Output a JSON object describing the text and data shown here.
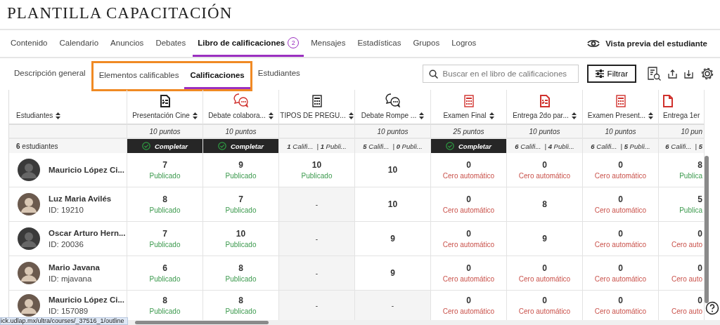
{
  "course_title": "PLANTILLA CAPACITACIÓN",
  "nav_tabs": [
    {
      "label": "Contenido",
      "selected": false
    },
    {
      "label": "Calendario",
      "selected": false
    },
    {
      "label": "Anuncios",
      "selected": false
    },
    {
      "label": "Debates",
      "selected": false
    },
    {
      "label": "Libro de calificaciones",
      "badge": "2",
      "selected": true
    },
    {
      "label": "Mensajes",
      "selected": false
    },
    {
      "label": "Estadísticas",
      "selected": false
    },
    {
      "label": "Grupos",
      "selected": false
    },
    {
      "label": "Logros",
      "selected": false
    }
  ],
  "student_preview": "Vista previa del estudiante",
  "sub_tabs": [
    {
      "label": "Descripción general",
      "selected": false,
      "highlighted": false
    },
    {
      "label": "Elementos calificables",
      "selected": false,
      "highlighted": true
    },
    {
      "label": "Calificaciones",
      "selected": true,
      "highlighted": true
    },
    {
      "label": "Estudiantes",
      "selected": false,
      "highlighted": false
    }
  ],
  "search": {
    "placeholder": "Buscar en el libro de calificaciones"
  },
  "filter_button": "Filtrar",
  "table": {
    "student_header": "Estudiantes",
    "student_count": "**6** estudiantes",
    "columns": [
      {
        "title": "Presentación Cine",
        "kind": "assignment",
        "color": "#222222",
        "points": "10 puntos",
        "summary": {
          "kind": "complete",
          "text": "Completar"
        }
      },
      {
        "title": "Debate colabora...",
        "kind": "discussion",
        "color": "#d0312d",
        "points": "10 puntos",
        "summary": {
          "kind": "complete",
          "text": "Completar"
        }
      },
      {
        "title": "TIPOS DE PREGU...",
        "kind": "test",
        "color": "#222222",
        "summary": {
          "kind": "counts",
          "text": "**1** Califi...  | **1** Publi..."
        }
      },
      {
        "title": "Debate Rompe ...",
        "kind": "discussion",
        "color": "#222222",
        "points": "10 puntos",
        "summary": {
          "kind": "counts",
          "text": "**5** Califi...  | **0** Publi..."
        }
      },
      {
        "title": "Examen Final",
        "kind": "test",
        "color": "#d0312d",
        "points": "25 puntos",
        "summary": {
          "kind": "complete",
          "text": "Completar"
        }
      },
      {
        "title": "Entrega 2do par...",
        "kind": "assignment",
        "color": "#d0312d",
        "points": "10 puntos",
        "summary": {
          "kind": "counts",
          "text": "**6** Califi...  | **4** Publi..."
        }
      },
      {
        "title": "Examen Present...",
        "kind": "test",
        "color": "#d0312d",
        "points": "10 puntos",
        "summary": {
          "kind": "counts",
          "text": "**6** Califi...  | **5** Publi..."
        }
      },
      {
        "title": "Entrega 1er",
        "kind": "document",
        "color": "#d0312d",
        "points": "10 pun",
        "summary": {
          "kind": "counts",
          "text": "**6** Califi...  | **5**"
        }
      }
    ],
    "rows": [
      {
        "name": "Mauricio López Ci...",
        "avatar": {
          "kind": "default"
        },
        "cells": [
          {
            "kind": "published",
            "grade": "7",
            "status": "Publicado"
          },
          {
            "kind": "published",
            "grade": "9",
            "status": "Publicado"
          },
          {
            "kind": "published",
            "grade": "10",
            "status": "Publicado"
          },
          {
            "kind": "grade_only",
            "grade": "10"
          },
          {
            "kind": "auto_zero",
            "grade": "0",
            "status": "Cero automático"
          },
          {
            "kind": "auto_zero",
            "grade": "0",
            "status": "Cero automático"
          },
          {
            "kind": "auto_zero",
            "grade": "0",
            "status": "Cero automático"
          },
          {
            "kind": "published",
            "grade": "8",
            "status": "Publica"
          }
        ]
      },
      {
        "name": "Luz Maria Avilés",
        "id": "ID: 19210",
        "avatar": {
          "kind": "photo"
        },
        "cells": [
          {
            "kind": "published",
            "grade": "8",
            "status": "Publicado"
          },
          {
            "kind": "published",
            "grade": "7",
            "status": "Publicado"
          },
          {
            "kind": "empty",
            "grade": "-"
          },
          {
            "kind": "grade_only",
            "grade": "10"
          },
          {
            "kind": "auto_zero",
            "grade": "0",
            "status": "Cero automático"
          },
          {
            "kind": "grade_only",
            "grade": "8"
          },
          {
            "kind": "auto_zero",
            "grade": "0",
            "status": "Cero automático"
          },
          {
            "kind": "published",
            "grade": "5",
            "status": "Publica"
          }
        ]
      },
      {
        "name": "Oscar Arturo Hern...",
        "id": "ID: 20036",
        "avatar": {
          "kind": "default"
        },
        "cells": [
          {
            "kind": "published",
            "grade": "7",
            "status": "Publicado"
          },
          {
            "kind": "published",
            "grade": "10",
            "status": "Publicado"
          },
          {
            "kind": "empty",
            "grade": "-"
          },
          {
            "kind": "grade_only",
            "grade": "9"
          },
          {
            "kind": "auto_zero",
            "grade": "0",
            "status": "Cero automático"
          },
          {
            "kind": "grade_only",
            "grade": "9"
          },
          {
            "kind": "auto_zero",
            "grade": "0",
            "status": "Cero automático"
          },
          {
            "kind": "auto_zero",
            "grade": "0",
            "status": "Cero auto"
          }
        ]
      },
      {
        "name": "Mario Javana",
        "id": "ID: mjavana",
        "avatar": {
          "kind": "photo"
        },
        "cells": [
          {
            "kind": "published",
            "grade": "6",
            "status": "Publicado"
          },
          {
            "kind": "published",
            "grade": "8",
            "status": "Publicado"
          },
          {
            "kind": "empty",
            "grade": "-"
          },
          {
            "kind": "grade_only",
            "grade": "9"
          },
          {
            "kind": "auto_zero",
            "grade": "0",
            "status": "Cero automático"
          },
          {
            "kind": "auto_zero",
            "grade": "0",
            "status": "Cero automático"
          },
          {
            "kind": "auto_zero",
            "grade": "0",
            "status": "Cero automático"
          },
          {
            "kind": "auto_zero",
            "grade": "0",
            "status": "Cero auto"
          }
        ]
      },
      {
        "name": "Mauricio López Ci...",
        "id": "ID: 157089",
        "avatar": {
          "kind": "photo"
        },
        "cells": [
          {
            "kind": "published",
            "grade": "8",
            "status": "Publicado"
          },
          {
            "kind": "published",
            "grade": "8",
            "status": "Publicado"
          },
          {
            "kind": "empty",
            "grade": "-"
          },
          {
            "kind": "empty",
            "grade": "-"
          },
          {
            "kind": "auto_zero",
            "grade": "0",
            "status": "Cero automático"
          },
          {
            "kind": "auto_zero",
            "grade": "0",
            "status": "Cero automático"
          },
          {
            "kind": "auto_zero",
            "grade": "0",
            "status": "Cero automático"
          },
          {
            "kind": "auto_zero",
            "grade": "0",
            "status": "Cero auto"
          }
        ]
      }
    ]
  },
  "status_url": "ick.udlap.mx/ultra/courses/_37516_1/outline"
}
